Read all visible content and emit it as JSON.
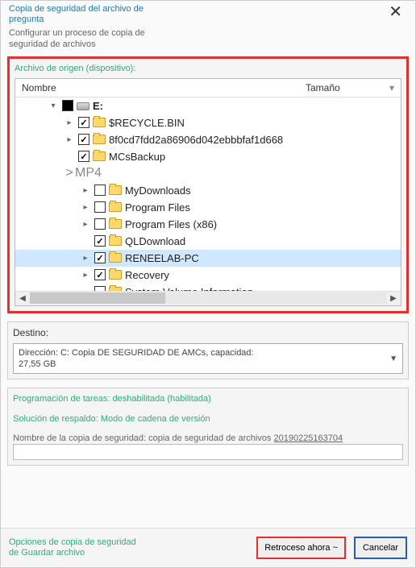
{
  "titlebar": {
    "title": "Copia de seguridad del archivo de pregunta",
    "close_glyph": "✕"
  },
  "subtitle": "Configurar un proceso de copia de seguridad de archivos",
  "source": {
    "label": "Archivo de origen (dispositivo):",
    "columns": {
      "name": "Nombre",
      "size": "Tamaño",
      "arrow": "▾"
    },
    "tree": [
      {
        "indent": 1,
        "expander": "down",
        "check": "tri",
        "icon": "drive",
        "label": "E:",
        "bold": true
      },
      {
        "indent": 2,
        "expander": "right",
        "check": "checked",
        "icon": "folder",
        "label": "$RECYCLE.BIN"
      },
      {
        "indent": 2,
        "expander": "right",
        "check": "checked",
        "icon": "folder",
        "label": "8f0cd7fdd2a86906d042ebbbfaf1d668"
      },
      {
        "indent": 2,
        "expander": "none",
        "check": "checked",
        "icon": "folder",
        "label": "MCsBackup"
      },
      {
        "indent": 2,
        "expander": "big",
        "check": "none",
        "icon": "none",
        "label": "MP4",
        "big": true
      },
      {
        "indent": 3,
        "expander": "right",
        "check": "unchecked",
        "icon": "folder",
        "label": "MyDownloads"
      },
      {
        "indent": 3,
        "expander": "right",
        "check": "unchecked",
        "icon": "folder",
        "label": "Program Files"
      },
      {
        "indent": 3,
        "expander": "right",
        "check": "unchecked",
        "icon": "folder",
        "label": "Program Files (x86)"
      },
      {
        "indent": 3,
        "expander": "none",
        "check": "checked",
        "icon": "folder",
        "label": "QLDownload"
      },
      {
        "indent": 3,
        "expander": "right",
        "check": "checked",
        "icon": "folder",
        "label": "RENEELAB-PC",
        "selected": true
      },
      {
        "indent": 3,
        "expander": "right",
        "check": "checked",
        "icon": "folder",
        "label": "Recovery"
      },
      {
        "indent": 3,
        "expander": "none",
        "check": "unchecked",
        "icon": "folder",
        "label": "System Volume Information"
      }
    ],
    "scroll": {
      "left": "◀",
      "right": "▶"
    }
  },
  "destination": {
    "label": "Destino:",
    "text_line1": "Dirección: C: Copia DE SEGURIDAD DE AMCs, capacidad:",
    "text_line2": "27,55 GB",
    "arrow": "▼"
  },
  "schedule": {
    "sched_label": "Programación de tareas: deshabilitada (habilitada)",
    "solution_label": "Solución de respaldo: Modo de cadena de versión",
    "name_label_prefix": "Nombre de la copia de seguridad: copia de seguridad de archivos ",
    "name_label_uline": "20190225163704"
  },
  "footer": {
    "options_link": "Opciones de copia de seguridad de Guardar archivo",
    "primary_btn": "Retroceso ahora ~",
    "secondary_btn": "Cancelar"
  }
}
